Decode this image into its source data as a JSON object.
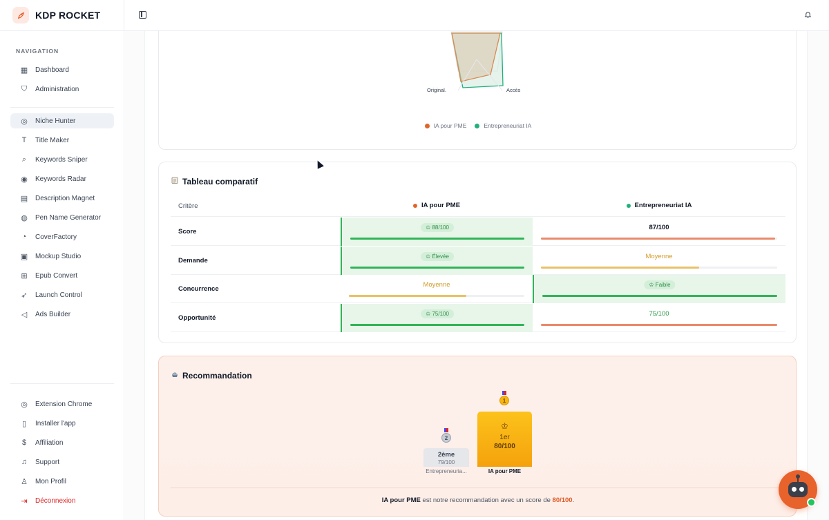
{
  "brand": {
    "name": "KDP ROCKET"
  },
  "sidebar": {
    "heading": "NAVIGATION",
    "items": [
      {
        "label": "Dashboard",
        "icon": "grid-icon"
      },
      {
        "label": "Administration",
        "icon": "shield-icon"
      },
      {
        "label": "Niche Hunter",
        "icon": "target-icon",
        "active": true
      },
      {
        "label": "Title Maker",
        "icon": "type-icon"
      },
      {
        "label": "Keywords Sniper",
        "icon": "search-icon"
      },
      {
        "label": "Keywords Radar",
        "icon": "radar-icon"
      },
      {
        "label": "Description Magnet",
        "icon": "file-text-icon"
      },
      {
        "label": "Pen Name Generator",
        "icon": "user-circle-icon"
      },
      {
        "label": "CoverFactory",
        "icon": "palette-icon"
      },
      {
        "label": "Mockup Studio",
        "icon": "box-icon"
      },
      {
        "label": "Epub Convert",
        "icon": "file-plus-icon"
      },
      {
        "label": "Launch Control",
        "icon": "rocket-icon"
      },
      {
        "label": "Ads Builder",
        "icon": "megaphone-icon"
      }
    ],
    "bottom_items": [
      {
        "label": "Extension Chrome",
        "icon": "chrome-icon"
      },
      {
        "label": "Installer l'app",
        "icon": "smartphone-icon"
      },
      {
        "label": "Affiliation",
        "icon": "dollar-icon"
      },
      {
        "label": "Support",
        "icon": "headphones-icon"
      },
      {
        "label": "Mon Profil",
        "icon": "user-icon"
      },
      {
        "label": "Déconnexion",
        "icon": "logout-icon",
        "danger": true
      }
    ]
  },
  "radar": {
    "axis_labels": {
      "left": "Original.",
      "right": "Accès"
    },
    "series": [
      {
        "name": "IA pour PME",
        "color": "#e0652a"
      },
      {
        "name": "Entrepreneuriat IA",
        "color": "#22b07d"
      }
    ]
  },
  "table": {
    "title": "Tableau comparatif",
    "title_icon": "clipboard-icon",
    "columns": {
      "criterion": "Critère",
      "a": "IA pour PME",
      "b": "Entrepreneuriat IA"
    },
    "colors": {
      "a": "#e0652a",
      "b": "#22b07d"
    },
    "rows": [
      {
        "label": "Score",
        "a": {
          "text": "88/100",
          "win": true,
          "level": 1.0,
          "bar": "#2fb457"
        },
        "b": {
          "text": "87/100",
          "win": false,
          "style": "strong",
          "level": 0.99,
          "bar": "#e98a6b"
        }
      },
      {
        "label": "Demande",
        "a": {
          "text": "Élevée",
          "win": true,
          "level": 1.0,
          "bar": "#2fb457"
        },
        "b": {
          "text": "Moyenne",
          "win": false,
          "style": "yellow",
          "level": 0.67,
          "bar": "#e9c166"
        }
      },
      {
        "label": "Concurrence",
        "a": {
          "text": "Moyenne",
          "win": false,
          "style": "yellow",
          "level": 0.67,
          "bar": "#e9c166"
        },
        "b": {
          "text": "Faible",
          "win": true,
          "level": 1.0,
          "bar": "#2fb457"
        }
      },
      {
        "label": "Opportunité",
        "a": {
          "text": "75/100",
          "win": true,
          "level": 1.0,
          "bar": "#2fb457"
        },
        "b": {
          "text": "75/100",
          "win": false,
          "style": "green",
          "level": 1.0,
          "bar": "#e98a6b"
        }
      }
    ]
  },
  "reco": {
    "title": "Recommandation",
    "title_icon": "trophy-icon",
    "first": {
      "position": "1er",
      "score": "80/100",
      "name": "IA pour PME",
      "medal": "1"
    },
    "second": {
      "position": "2ème",
      "score": "79/100",
      "name": "Entrepreneuria...",
      "medal": "2"
    },
    "summary": {
      "name": "IA pour PME",
      "middle": " est notre recommandation avec un score de ",
      "score": "80/100",
      "end": "."
    }
  }
}
